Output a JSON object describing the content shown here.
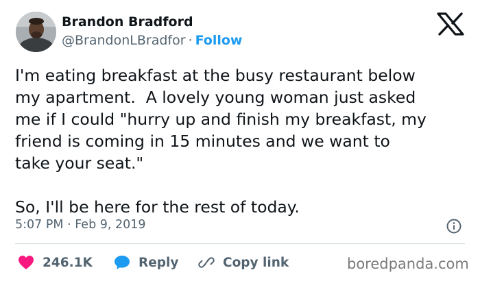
{
  "author": {
    "name": "Brandon Bradford",
    "handle": "@BrandonLBradfor",
    "separator": "·",
    "follow_label": "Follow",
    "avatar_icon": "user-avatar-photo"
  },
  "platform_icon": "x-logo-icon",
  "tweet": {
    "text": "I'm eating breakfast at the busy restaurant below\nmy apartment.  A lovely young woman just asked\nme if I could \"hurry up and finish my breakfast, my\nfriend is coming in 15 minutes and we want to\ntake your seat.\"\n\nSo, I'll be here for the rest of today.",
    "timestamp": "5:07 PM · Feb 9, 2019"
  },
  "actions": {
    "like_count": "246.1K",
    "reply_label": "Reply",
    "copy_link_label": "Copy link"
  },
  "watermark": "boredpanda.com",
  "colors": {
    "accent": "#1d9bf0",
    "like": "#f91880",
    "text": "#0f1419",
    "muted": "#536471"
  }
}
